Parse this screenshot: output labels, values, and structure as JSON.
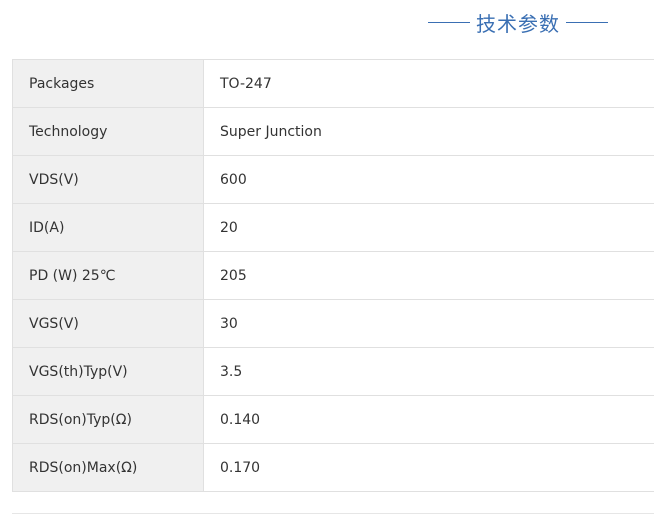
{
  "section": {
    "title": "技术参数"
  },
  "specs": [
    {
      "key": "Packages",
      "value": "TO-247"
    },
    {
      "key": "Technology",
      "value": "Super Junction"
    },
    {
      "key": "VDS(V)",
      "value": "600"
    },
    {
      "key": "ID(A)",
      "value": "20"
    },
    {
      "key": "PD (W) 25℃",
      "value": "205"
    },
    {
      "key": "VGS(V)",
      "value": "30"
    },
    {
      "key": "VGS(th)Typ(V)",
      "value": "3.5"
    },
    {
      "key": "RDS(on)Typ(Ω)",
      "value": "0.140"
    },
    {
      "key": "RDS(on)Max(Ω)",
      "value": "0.170"
    }
  ],
  "colors": {
    "accent": "#3a6fb3",
    "key_cell_bg": "#f0f0f0",
    "border": "#e0e0e0",
    "text": "#333333"
  }
}
